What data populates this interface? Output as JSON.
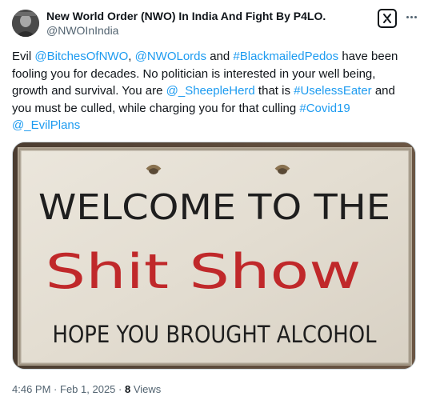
{
  "author": {
    "display_name": "New World Order (NWO) In India And Fight By P4LO.",
    "handle": "@NWOInIndia"
  },
  "tweet": {
    "segments": [
      {
        "text": "Evil ",
        "link": false
      },
      {
        "text": "@BitchesOfNWO",
        "link": true
      },
      {
        "text": ", ",
        "link": false
      },
      {
        "text": "@NWOLords",
        "link": true
      },
      {
        "text": " and ",
        "link": false
      },
      {
        "text": "#BlackmailedPedos",
        "link": true
      },
      {
        "text": " have been fooling you for decades. No politician is interested in your well being, growth and survival. You are ",
        "link": false
      },
      {
        "text": "@_SheepleHerd",
        "link": true
      },
      {
        "text": " that is ",
        "link": false
      },
      {
        "text": "#UselessEater",
        "link": true
      },
      {
        "text": " and you must be culled, while charging you for that culling ",
        "link": false
      },
      {
        "text": "#Covid19",
        "link": true
      },
      {
        "text": " ",
        "link": false
      },
      {
        "text": "@_EvilPlans",
        "link": true
      }
    ]
  },
  "sign": {
    "line1": "WELCOME TO THE",
    "line2": "Shit Show",
    "line3": "HOPE YOU BROUGHT ALCOHOL"
  },
  "meta": {
    "time": "4:46 PM",
    "date": "Feb 1, 2025",
    "separator": "·",
    "views_count": "8",
    "views_label": "Views"
  },
  "colors": {
    "link": "#1d9bf0",
    "text": "#0f1419",
    "muted": "#536471",
    "sign_red": "#c0282a"
  },
  "icons": [
    "grok-icon",
    "more-icon"
  ]
}
